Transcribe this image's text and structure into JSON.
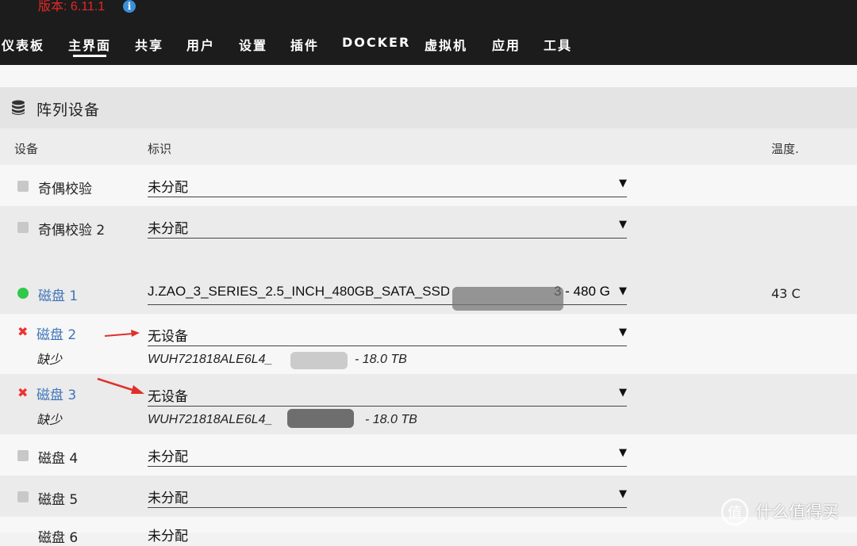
{
  "header": {
    "version": "版本: 6.11.1",
    "info_icon": "info-icon",
    "nav": [
      "仪表板",
      "主界面",
      "共享",
      "用户",
      "设置",
      "插件",
      "DOCKER",
      "虚拟机",
      "应用",
      "工具"
    ],
    "active_tab": "主界面"
  },
  "panel": {
    "title": "阵列设备",
    "icon": "database-icon",
    "columns": {
      "device": "设备",
      "identity": "标识",
      "temp": "温度."
    }
  },
  "rows": [
    {
      "name": "奇偶校验",
      "status": "gray",
      "value": "未分配"
    },
    {
      "name": "奇偶校验 2",
      "status": "gray",
      "value": "未分配"
    },
    {
      "name": "磁盘 1",
      "status": "green",
      "value": "J.ZAO_3_SERIES_2.5_INCH_480GB_SATA_SSD_",
      "value_tail": "3 - 480 G",
      "temp": "43 C"
    },
    {
      "name": "磁盘 2",
      "status": "red",
      "missing": "缺少",
      "value": "无设备",
      "serial": "WUH721818ALE6L4_",
      "serial_tail": "- 18.0 TB"
    },
    {
      "name": "磁盘 3",
      "status": "red",
      "missing": "缺少",
      "value": "无设备",
      "serial": "WUH721818ALE6L4_",
      "serial_tail": "- 18.0 TB"
    },
    {
      "name": "磁盘 4",
      "status": "gray",
      "value": "未分配"
    },
    {
      "name": "磁盘 5",
      "status": "gray",
      "value": "未分配"
    },
    {
      "name": "磁盘 6",
      "status": "gray",
      "value": "未分配"
    }
  ],
  "watermark": "什么值得买",
  "watermark_icon": "zhide-logo-icon",
  "colors": {
    "accent_red": "#e22828",
    "link_blue": "#3f74b8",
    "ok_green": "#2fc94a",
    "annotation_red": "#e0302a"
  }
}
